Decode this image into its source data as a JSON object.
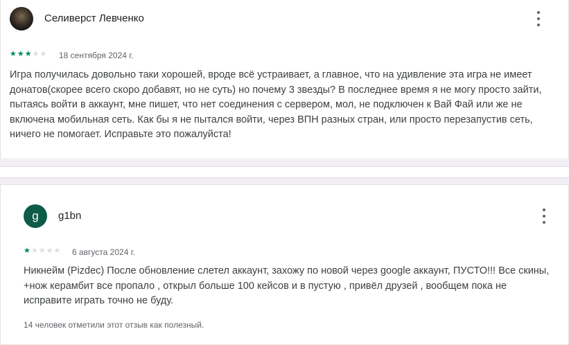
{
  "reviews": [
    {
      "author": "Селиверст Левченко",
      "rating": 3,
      "max_rating": 5,
      "date": "18 сентября 2024 г.",
      "text": "Игра получилась довольно таки хорошей, вроде всё устраивает, а главное, что на удивление эта игра не имеет донатов(скорее всего скоро добавят, но не суть) но почему 3 звезды? В последнее время я не могу просто зайти, пытаясь войти в аккаунт, мне пишет, что нет соединения с сервером, мол, не подключен к Вай Фай или же не включена мобильная сеть. Как бы я не пытался войти, через ВПН разных стран, или просто перезапустив сеть, ничего не помогает. Исправьте это пожалуйста!"
    },
    {
      "author": "g1bn",
      "avatar_letter": "g",
      "rating": 1,
      "max_rating": 5,
      "date": "6 августа 2024 г.",
      "text": "Никнейм (Pizdec) После обновление слетел аккаунт, захожу по новой через google аккаунт, ПУСТО!!! Все скины, +нож керамбит все пропало , открыл больше 100 кейсов и в пустую , привёл друзей , вообщем пока не исправите играть точно не буду.",
      "helpful": "14 человек отметили этот отзыв как полезный."
    }
  ],
  "colors": {
    "star_filled": "#01875f",
    "star_empty": "#dadce0",
    "avatar_g": "#0d5b48"
  },
  "icons": {
    "menu": "more-vert-icon",
    "star": "star-icon"
  }
}
